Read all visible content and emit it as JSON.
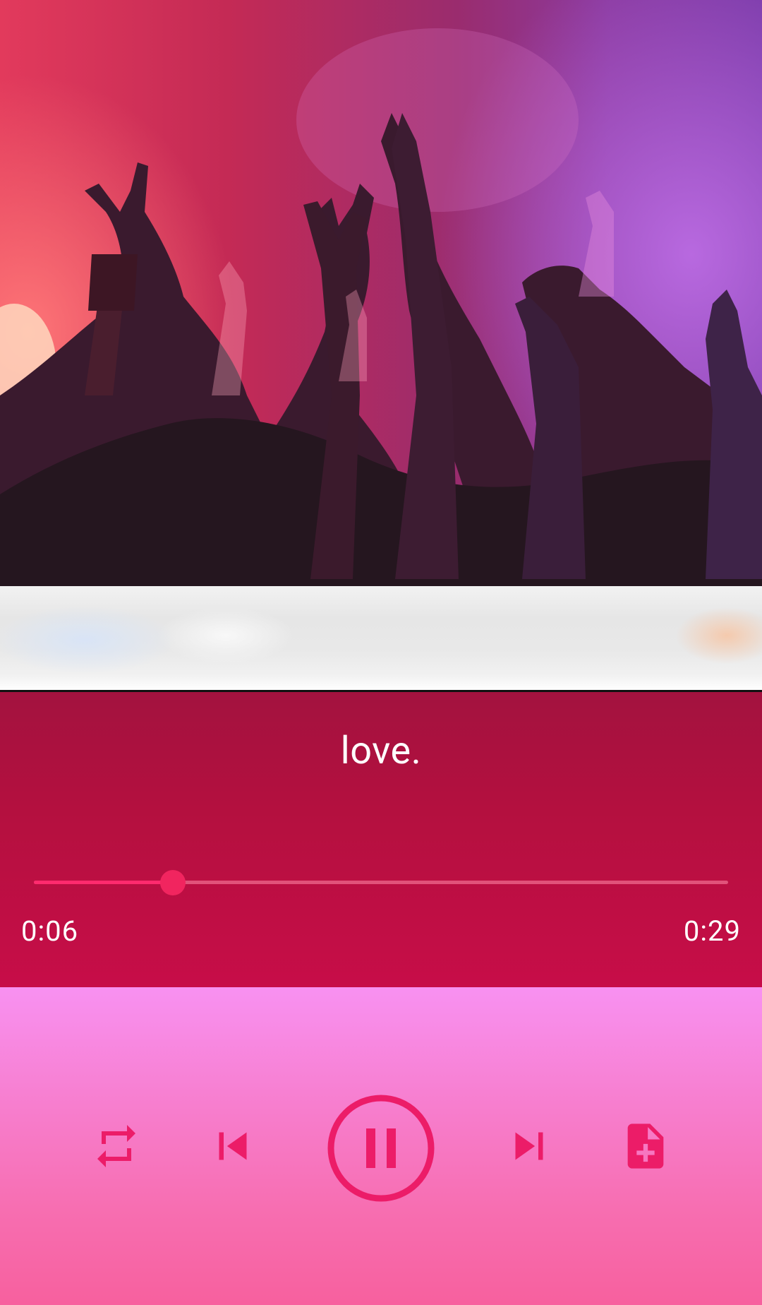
{
  "player": {
    "song_title": "love.",
    "time_current": "0:06",
    "time_total": "0:29",
    "progress_fraction": 0.2
  },
  "controls": {
    "repeat_icon": "repeat-icon",
    "previous_icon": "skip-previous-icon",
    "play_pause_icon": "pause-circle-icon",
    "next_icon": "skip-next-icon",
    "add_icon": "note-add-icon"
  },
  "colors": {
    "accent": "#ec1c68",
    "info_panel": "#b4103f",
    "controls_panel": "#f77fd0"
  }
}
